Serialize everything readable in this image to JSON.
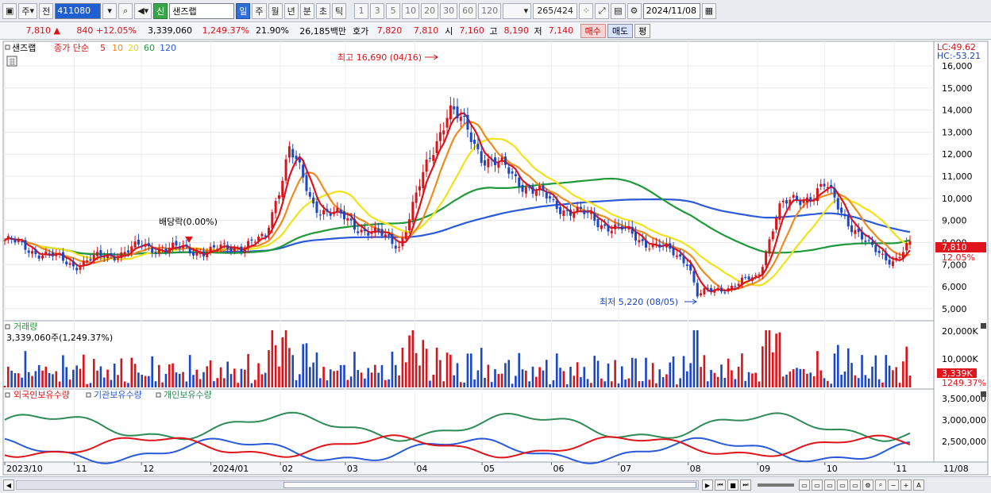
{
  "toolbar": {
    "period_main": "주",
    "prev": "전",
    "stock_code": "411080",
    "market_tag": "신",
    "stock_name": "샌즈랩",
    "periods": [
      "일",
      "주",
      "월",
      "년",
      "분",
      "초",
      "틱"
    ],
    "selected_period": "일",
    "intervals": [
      "1",
      "3",
      "5",
      "10",
      "20",
      "30",
      "60",
      "120"
    ],
    "count_value": "265",
    "count_total": "/424",
    "date": "2024/11/08"
  },
  "infobar": {
    "price": "7,810",
    "arrow": "▲",
    "change": "840",
    "change_pct": "+12.05%",
    "volume": "3,339,060",
    "volume_pct": "1,249.37%",
    "turnover": "21.90%",
    "amount": "26,185백만",
    "hoga_label": "호가",
    "hoga_ask": "7,820",
    "hoga_bid": "7,810",
    "open_label": "시",
    "open": "7,160",
    "high_label": "고",
    "high": "8,190",
    "low_label": "저",
    "low": "7,140",
    "buy_label": "매수",
    "sell_label": "매도",
    "flat_label": "평"
  },
  "price_panel": {
    "name_tag": "샌즈랩",
    "ma_title": "종가 단순",
    "ma_periods": [
      "5",
      "10",
      "20",
      "60",
      "120"
    ],
    "lc_label": "LC:49.62",
    "hc_label": "HC:-53.21",
    "high_annotation": "최고 16,690 (04/16)",
    "low_annotation": "최저 5,220 (08/05)",
    "dividend_annotation": "배당락(0.00%)",
    "current_price_tag": "7,810",
    "current_pct_tag": "12.05%",
    "y_ticks": [
      "16,000",
      "15,000",
      "14,000",
      "13,000",
      "12,000",
      "11,000",
      "10,000",
      "9,000",
      "8,000",
      "7,000",
      "6,000",
      "5,000"
    ]
  },
  "volume_panel": {
    "title": "거래량",
    "value_label": "3,339,060주(1,249.37%)",
    "y_ticks": [
      "20,000K",
      "10,000K"
    ],
    "current_tag": "3,339K",
    "current_pct_tag": "1249.37%"
  },
  "holdings_panel": {
    "labels": [
      "외국인보유수량",
      "기관보유수량",
      "개인보유수량"
    ],
    "y_ticks": [
      "3,500,000",
      "3,000,000",
      "2,500,000"
    ]
  },
  "x_axis": {
    "labels": [
      "2023/10",
      "11",
      "12",
      "2024/01",
      "02",
      "03",
      "04",
      "05",
      "06",
      "07",
      "08",
      "09",
      "10",
      "11"
    ],
    "end_label": "11/08"
  },
  "colors": {
    "up": "#d9131a",
    "down": "#1b46c4",
    "ma5": "#e0141b",
    "ma10": "#f08a1c",
    "ma20": "#f2e21a",
    "ma60": "#1f9a3a",
    "ma120": "#2a5ad8",
    "foreign": "#e0141b",
    "institution": "#2a5ad8",
    "individual": "#2e8b57"
  },
  "chart_data": {
    "type": "candlestick",
    "price_range": [
      4600,
      16900
    ],
    "key_points": [
      {
        "date": "2023/10/01",
        "price": 8100
      },
      {
        "date": "2023/11/01",
        "price": 7000
      },
      {
        "date": "2023/12/01",
        "price": 7800
      },
      {
        "date": "2024/01/01",
        "price": 7600
      },
      {
        "date": "2024/01/25",
        "price": 8100
      },
      {
        "date": "2024/02/05",
        "price": 12300
      },
      {
        "date": "2024/02/15",
        "price": 9800
      },
      {
        "date": "2024/03/01",
        "price": 9000
      },
      {
        "date": "2024/03/25",
        "price": 7900
      },
      {
        "date": "2024/04/05",
        "price": 11000
      },
      {
        "date": "2024/04/16",
        "price": 14200
      },
      {
        "date": "2024/05/01",
        "price": 12000
      },
      {
        "date": "2024/06/01",
        "price": 9800
      },
      {
        "date": "2024/07/01",
        "price": 8600
      },
      {
        "date": "2024/08/01",
        "price": 7200
      },
      {
        "date": "2024/08/05",
        "price": 5600
      },
      {
        "date": "2024/09/01",
        "price": 6400
      },
      {
        "date": "2024/09/10",
        "price": 9500
      },
      {
        "date": "2024/10/01",
        "price": 10500
      },
      {
        "date": "2024/10/20",
        "price": 7800
      },
      {
        "date": "2024/11/01",
        "price": 7200
      },
      {
        "date": "2024/11/08",
        "price": 7810
      }
    ],
    "series": [
      {
        "name": "5",
        "role": "ma"
      },
      {
        "name": "10",
        "role": "ma"
      },
      {
        "name": "20",
        "role": "ma"
      },
      {
        "name": "60",
        "role": "ma"
      },
      {
        "name": "120",
        "role": "ma"
      }
    ],
    "holdings": {
      "range": [
        2100000,
        3700000
      ],
      "foreign_level": 2300000,
      "institution_level": 2350000,
      "individual_level": 3350000
    }
  }
}
